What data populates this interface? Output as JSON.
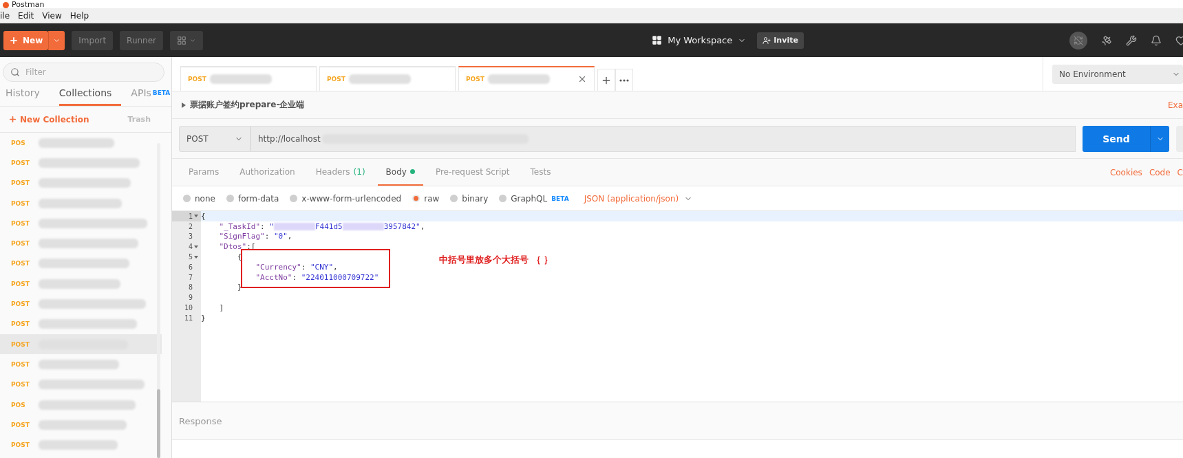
{
  "window": {
    "title": "Postman"
  },
  "menu": [
    "ile",
    "Edit",
    "View",
    "Help"
  ],
  "header": {
    "new_button": "New",
    "import_button": "Import",
    "runner_button": "Runner",
    "workspace": "My Workspace",
    "invite_button": "Invite"
  },
  "sidebar": {
    "filter_placeholder": "Filter",
    "tabs": [
      {
        "label": "History",
        "selected": false
      },
      {
        "label": "Collections",
        "selected": true
      },
      {
        "label": "APIs",
        "selected": false,
        "badge": "BETA"
      }
    ],
    "new_collection": "New Collection",
    "trash": "Trash",
    "items": [
      {
        "method": "POS",
        "selected": false
      },
      {
        "method": "POST",
        "selected": false
      },
      {
        "method": "POST",
        "selected": false
      },
      {
        "method": "POST",
        "selected": false
      },
      {
        "method": "POST",
        "selected": false
      },
      {
        "method": "POST",
        "selected": false
      },
      {
        "method": "POST",
        "selected": false
      },
      {
        "method": "POST",
        "selected": false
      },
      {
        "method": "POST",
        "selected": false
      },
      {
        "method": "POST",
        "selected": false
      },
      {
        "method": "POST",
        "selected": true
      },
      {
        "method": "POST",
        "selected": false
      },
      {
        "method": "POST",
        "selected": false
      },
      {
        "method": "POS",
        "selected": false
      },
      {
        "method": "POST",
        "selected": false
      },
      {
        "method": "POST",
        "selected": false
      }
    ]
  },
  "request_tabs": [
    {
      "method": "POST",
      "selected": false
    },
    {
      "method": "POST",
      "selected": false
    },
    {
      "method": "POST",
      "selected": true
    }
  ],
  "environment": "No Environment",
  "request": {
    "name": "票据账户签约prepare-企业端",
    "examples_link": "Exa",
    "method": "POST",
    "url": "http://localhost",
    "send_button": "Send"
  },
  "request_sections": [
    {
      "label": "Params",
      "selected": false,
      "dot": false
    },
    {
      "label": "Authorization",
      "selected": false,
      "dot": false
    },
    {
      "label": "Headers",
      "count": "(1)",
      "selected": false,
      "dot": false
    },
    {
      "label": "Body",
      "selected": true,
      "dot": true
    },
    {
      "label": "Pre-request Script",
      "selected": false,
      "dot": false
    },
    {
      "label": "Tests",
      "selected": false,
      "dot": false
    }
  ],
  "side_links": [
    "Cookies",
    "Code",
    "C"
  ],
  "body_types": [
    {
      "label": "none",
      "selected": false
    },
    {
      "label": "form-data",
      "selected": false
    },
    {
      "label": "x-www-form-urlencoded",
      "selected": false
    },
    {
      "label": "raw",
      "selected": true
    },
    {
      "label": "binary",
      "selected": false
    },
    {
      "label": "GraphQL",
      "selected": false,
      "badge": "BETA"
    }
  ],
  "content_type": "JSON (application/json)",
  "editor": {
    "lines": [
      {
        "number": "1",
        "fold": true,
        "tokens": [
          {
            "kind": "punct",
            "text": "{"
          }
        ]
      },
      {
        "number": "2",
        "fold": false,
        "tokens": [
          {
            "kind": "key",
            "text": "    \"_TaskId\""
          },
          {
            "kind": "punct",
            "text": ": "
          },
          {
            "kind": "string",
            "text": "\""
          },
          {
            "kind": "redacted"
          },
          {
            "kind": "string",
            "text": "F441d5"
          },
          {
            "kind": "redacted"
          },
          {
            "kind": "string",
            "text": "3957842\""
          },
          {
            "kind": "punct",
            "text": ","
          }
        ]
      },
      {
        "number": "3",
        "fold": false,
        "tokens": [
          {
            "kind": "key",
            "text": "    \"SignFlag\""
          },
          {
            "kind": "punct",
            "text": ": "
          },
          {
            "kind": "string",
            "text": "\"0\""
          },
          {
            "kind": "punct",
            "text": ","
          }
        ]
      },
      {
        "number": "4",
        "fold": true,
        "tokens": [
          {
            "kind": "key",
            "text": "    \"Dtos\""
          },
          {
            "kind": "punct",
            "text": ":["
          }
        ]
      },
      {
        "number": "5",
        "fold": true,
        "tokens": [
          {
            "kind": "punct",
            "text": "        {"
          }
        ]
      },
      {
        "number": "6",
        "fold": false,
        "tokens": [
          {
            "kind": "key",
            "text": "            \"Currency\""
          },
          {
            "kind": "punct",
            "text": ": "
          },
          {
            "kind": "string",
            "text": "\"CNY\""
          },
          {
            "kind": "punct",
            "text": ","
          }
        ]
      },
      {
        "number": "7",
        "fold": false,
        "tokens": [
          {
            "kind": "key",
            "text": "            \"AcctNo\""
          },
          {
            "kind": "punct",
            "text": ": "
          },
          {
            "kind": "string",
            "text": "\"224011000709722\""
          }
        ]
      },
      {
        "number": "8",
        "fold": false,
        "tokens": [
          {
            "kind": "punct",
            "text": "        }"
          }
        ]
      },
      {
        "number": "9",
        "fold": false
      },
      {
        "number": "10",
        "fold": false,
        "tokens": [
          {
            "kind": "punct",
            "text": "    ]"
          }
        ]
      },
      {
        "number": "11",
        "fold": false,
        "tokens": [
          {
            "kind": "punct",
            "text": "}"
          }
        ]
      }
    ],
    "annotation": "中括号里放多个大括号 ｛ ｝"
  },
  "response": {
    "title": "Response"
  }
}
